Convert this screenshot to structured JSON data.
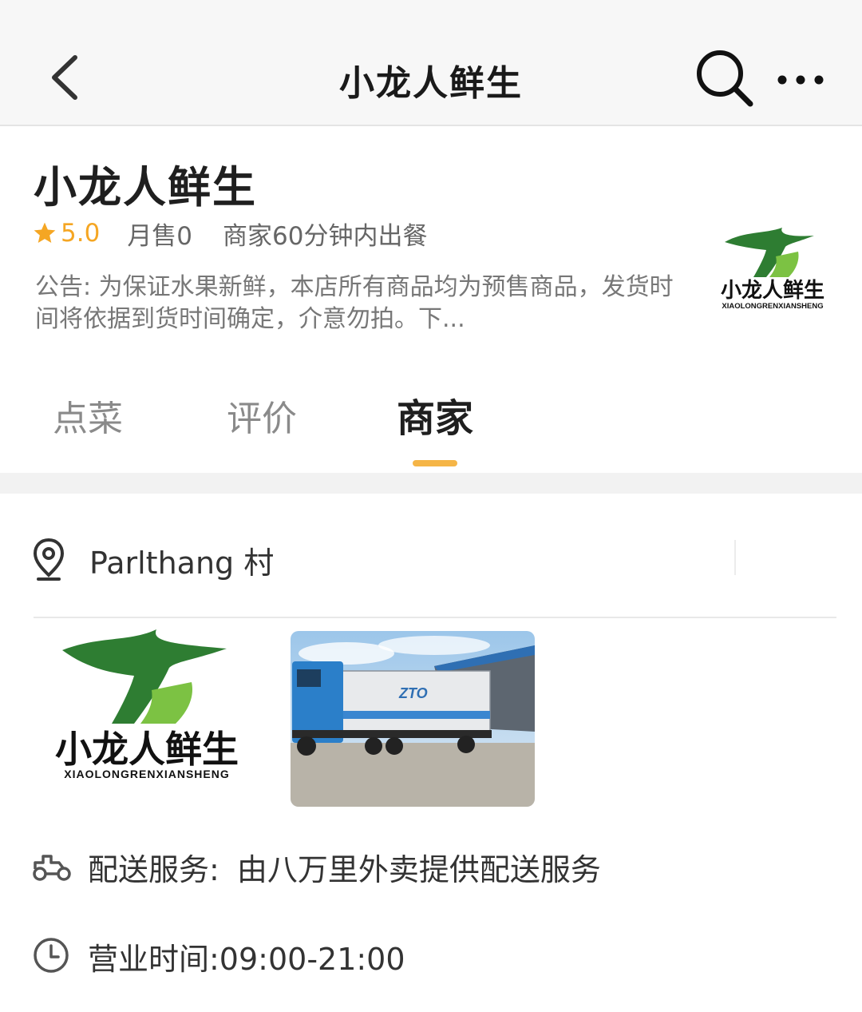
{
  "nav": {
    "title": "小龙人鲜生",
    "back_icon": "chevron-left-icon",
    "search_icon": "search-icon",
    "more_icon": "more-dots-icon"
  },
  "shop": {
    "name": "小龙人鲜生",
    "rating": "5.0",
    "monthly_sales": "月售0",
    "prep_time": "商家60分钟内出餐",
    "notice": "公告: 为保证水果新鲜，本店所有商品均为预售商品，发货时间将依据到货时间确定，介意勿拍。下...",
    "logo_text": "小龙人鲜生",
    "logo_subtext": "XIAOLONGRENXIANSHENG"
  },
  "tabs": [
    {
      "label": "点菜",
      "active": false
    },
    {
      "label": "评价",
      "active": false
    },
    {
      "label": "商家",
      "active": true
    }
  ],
  "merchant": {
    "address": "Parlthang 村",
    "delivery_label": "配送服务:",
    "delivery_value": "由八万里外卖提供配送服务",
    "hours": "营业时间:09:00-21:00",
    "truck_text": "ZTO"
  },
  "colors": {
    "accent": "#f5b547",
    "rating": "#f5a623",
    "logo_green_dark": "#2e7d32",
    "logo_green_light": "#7cc243"
  }
}
